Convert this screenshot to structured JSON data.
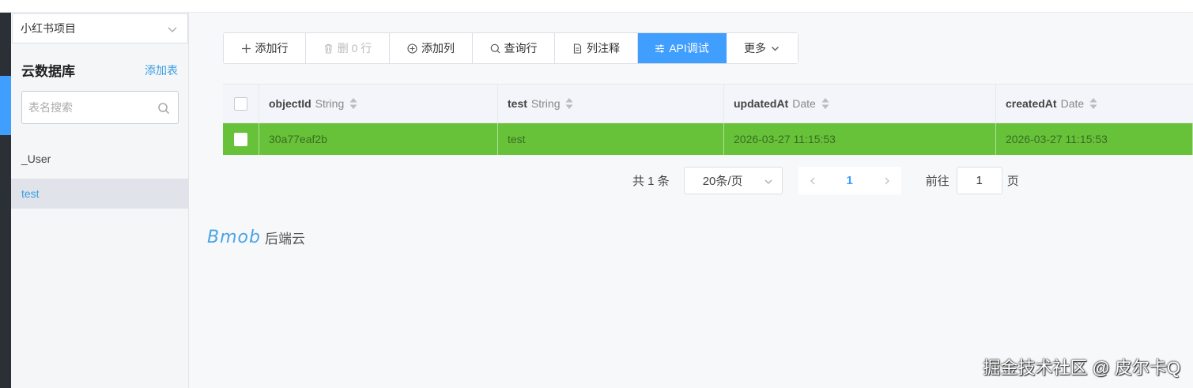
{
  "sidebar": {
    "project_name": "小红书项目",
    "section_title": "云数据库",
    "add_table_label": "添加表",
    "search_placeholder": "表名搜索",
    "tables": [
      "_User",
      "test"
    ],
    "active_table": "test"
  },
  "toolbar": {
    "add_row": "添加行",
    "delete_rows": "删 0 行",
    "add_column": "添加列",
    "query_row": "查询行",
    "column_comment": "列注释",
    "api_debug": "API调试",
    "more": "更多"
  },
  "table": {
    "columns": [
      {
        "name": "objectId",
        "type": "String"
      },
      {
        "name": "test",
        "type": "String"
      },
      {
        "name": "updatedAt",
        "type": "Date"
      },
      {
        "name": "createdAt",
        "type": "Date"
      }
    ],
    "rows": [
      [
        "30a77eaf2b",
        "test",
        "2026-03-27 11:15:53",
        "2026-03-27 11:15:53"
      ]
    ],
    "selected_row_color": "#67c23a"
  },
  "pagination": {
    "total_text": "共 1 条",
    "page_size": "20条/页",
    "current_page": "1",
    "goto_prefix": "前往",
    "goto_value": "1",
    "goto_suffix": "页"
  },
  "brand": {
    "logo_text": "Bmob",
    "suffix": "后端云"
  },
  "watermark": "掘金技术社区 @ 皮尔卡Q",
  "colors": {
    "accent": "#409eff",
    "link": "#3c9fe0",
    "rail": "#2b2f36"
  }
}
